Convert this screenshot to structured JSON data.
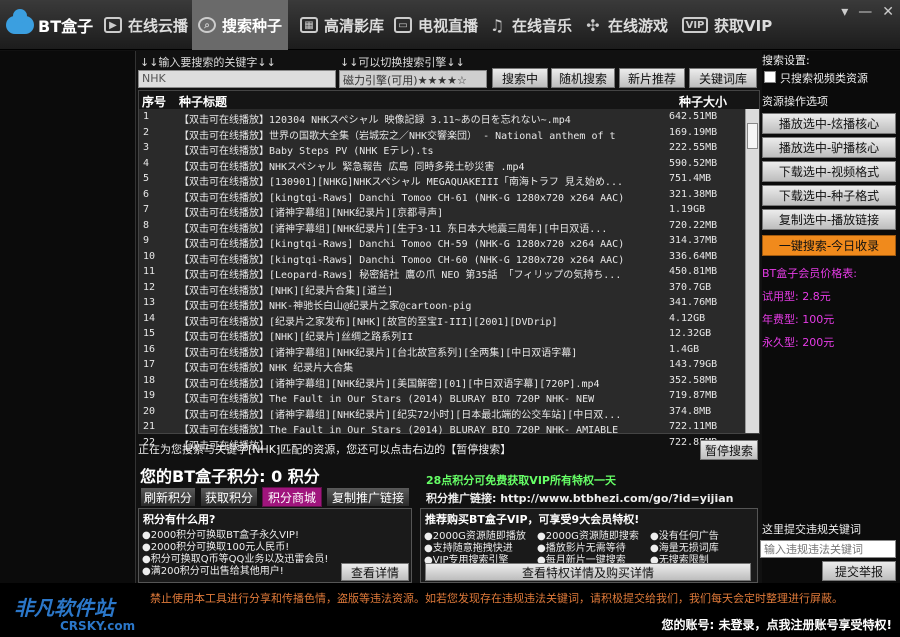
{
  "app": {
    "logo": "BT盒子",
    "window_buttons": [
      "▾",
      "—",
      "✕"
    ]
  },
  "nav": [
    {
      "label": "在线云播",
      "icon": "play-icon"
    },
    {
      "label": "搜索种子",
      "icon": "search-icon",
      "active": true
    },
    {
      "label": "高清影库",
      "icon": "film-icon"
    },
    {
      "label": "电视直播",
      "icon": "tv-icon"
    },
    {
      "label": "在线音乐",
      "icon": "music-icon"
    },
    {
      "label": "在线游戏",
      "icon": "pinwheel-icon"
    },
    {
      "label": "获取VIP",
      "icon": "vip-icon"
    }
  ],
  "search": {
    "hint_keyword": "↓↓输入要搜索的关键字↓↓",
    "hint_engine": "↓↓可以切换搜索引擎↓↓",
    "keyword_value": "NHK",
    "engine_value": "磁力引擎(可用)★★★★☆",
    "btn_searching": "搜索中",
    "btn_random": "随机搜索",
    "btn_new": "新片推荐",
    "btn_keywords": "关键词库"
  },
  "table": {
    "headers": {
      "no": "序号",
      "title": "种子标题",
      "size": "种子大小"
    },
    "rows": [
      {
        "no": "1",
        "title": "【双击可在线播放】120304 NHKスペシャル 映像記録 3.11~あの日を忘れない~.mp4",
        "size": "642.51MB"
      },
      {
        "no": "2",
        "title": "【双击可在线播放】世界の国歌大全集（岩城宏之／NHK交響楽団） - National anthem of t",
        "size": "169.19MB"
      },
      {
        "no": "3",
        "title": "【双击可在线播放】Baby Steps PV (NHK Eテレ).ts",
        "size": "222.55MB"
      },
      {
        "no": "4",
        "title": "【双击可在线播放】NHKスペシャル 緊急報告 広島 同時多発土砂災害 .mp4",
        "size": "590.52MB"
      },
      {
        "no": "5",
        "title": "【双击可在线播放】[130901][NHKG]NHKスペシャル MEGAQUAKEIII「南海トラフ 見え始め...",
        "size": "751.4MB"
      },
      {
        "no": "6",
        "title": "【双击可在线播放】[kingtqi-Raws] Danchi Tomoo CH-61 (NHK-G 1280x720 x264 AAC)",
        "size": "321.38MB"
      },
      {
        "no": "7",
        "title": "【双击可在线播放】[诸神字幕组][NHK纪录片][京都寻声]",
        "size": "1.19GB"
      },
      {
        "no": "8",
        "title": "【双击可在线播放】[诸神字幕组][NHK纪录片][生于3·11 东日本大地震三周年][中日双语...",
        "size": "720.22MB"
      },
      {
        "no": "9",
        "title": "【双击可在线播放】[kingtqi-Raws] Danchi Tomoo CH-59 (NHK-G 1280x720 x264 AAC)",
        "size": "314.37MB"
      },
      {
        "no": "10",
        "title": "【双击可在线播放】[kingtqi-Raws] Danchi Tomoo CH-60 (NHK-G 1280x720 x264 AAC)",
        "size": "336.64MB"
      },
      {
        "no": "11",
        "title": "【双击可在线播放】[Leopard-Raws] 秘密結社 鷹の爪 NEO 第35話 「フィリップの気持ち...",
        "size": "450.81MB"
      },
      {
        "no": "12",
        "title": "【双击可在线播放】[NHK][纪录片合集][道兰]",
        "size": "370.7GB"
      },
      {
        "no": "13",
        "title": "【双击可在线播放】NHK-神驰长白山@纪录片之家@cartoon-pig",
        "size": "341.76MB"
      },
      {
        "no": "14",
        "title": "【双击可在线播放】[纪录片之家发布][NHK][故宫的至宝I-III][2001][DVDrip]",
        "size": "4.12GB"
      },
      {
        "no": "15",
        "title": "【双击可在线播放】[NHK][纪录片]丝绸之路系列II",
        "size": "12.32GB"
      },
      {
        "no": "16",
        "title": "【双击可在线播放】[诸神字幕组][NHK纪录片][台北故宫系列][全两集][中日双语字幕]",
        "size": "1.4GB"
      },
      {
        "no": "17",
        "title": "【双击可在线播放】NHK 纪录片大合集",
        "size": "143.79GB"
      },
      {
        "no": "18",
        "title": "【双击可在线播放】[诸神字幕组][NHK纪录片][美国解密][01][中日双语字幕][720P].mp4",
        "size": "352.58MB"
      },
      {
        "no": "19",
        "title": "【双击可在线播放】The Fault in Our Stars (2014) BLURAY BIO 720P NHK- NEW",
        "size": "719.87MB"
      },
      {
        "no": "20",
        "title": "【双击可在线播放】[诸神字幕组][NHK纪录片][纪实72小时][日本最北端的公交车站][中日双...",
        "size": "374.8MB"
      },
      {
        "no": "21",
        "title": "【双击可在线播放】The Fault in Our Stars (2014) BLURAY BIO 720P NHK- AMIABLE",
        "size": "722.11MB"
      },
      {
        "no": "22",
        "title": "【双击可在线播放】...",
        "size": "722.85MB"
      }
    ]
  },
  "status": {
    "text": "正在为您搜索与关键字[NHK]匹配的资源，您还可以点击右边的【暂停搜索】",
    "pause_btn": "暂停搜索"
  },
  "points": {
    "score_text": "您的BT盒子积分: 0 积分",
    "btn_refresh": "刷新积分",
    "btn_get": "获取积分",
    "btn_mall": "积分商城",
    "btn_copy": "复制推广链接",
    "green_promo": "28点积分可免费获取VIP所有特权一天",
    "link_label": "积分推广链接: http://www.btbhezi.com/go/?id=yijian"
  },
  "uses_box": {
    "title": "积分有什么用?",
    "items": [
      "●2000积分可换取BT盒子永久VIP!",
      "●2000积分可换取100元人民币!",
      "●积分可换取Q币等QQ业务以及迅雷会员!",
      "●满200积分可出售给其他用户!"
    ],
    "btn": "查看详情"
  },
  "vip_box": {
    "title": "推荐购买BT盒子VIP，可享受9大会员特权!",
    "items": [
      "●2000G资源随即播放",
      "●2000G资源随即搜索",
      "●没有任何广告",
      "●支持随意拖拽快进",
      "●播放影片无需等待",
      "●海量无损词库",
      "●VIP专用搜索引擎",
      "●每月新片一键搜索",
      "●无搜索限制"
    ],
    "btn": "查看特权详情及购买详情"
  },
  "right": {
    "settings_label": "搜索设置:",
    "checkbox_label": "只搜索视频类资源",
    "ops_label": "资源操作选项",
    "op_buttons": [
      "播放选中-炫播核心",
      "播放选中-驴播核心",
      "下载选中-视频格式",
      "下载选中-种子格式",
      "复制选中-播放链接"
    ],
    "orange_btn": "一键搜索-今日收录",
    "price_title": "BT盒子会员价格表:",
    "prices": [
      "试用型: 2.8元",
      "年费型: 100元",
      "永久型: 200元"
    ],
    "report_label": "这里提交违规关键词",
    "report_placeholder": "输入违规违法关键词",
    "report_btn": "提交举报"
  },
  "footer": {
    "ticker": "禁止使用本工具进行分享和传播色情，盗版等违法资源。如若您发现存在违规违法关键词，请积极提交给我们，我们每天会定时整理进行屏蔽。",
    "account": "您的账号: 未登录，点我注册账号享受特权!",
    "watermark": "非凡软件站",
    "watermark_sub": "CRSKY.com"
  },
  "colors": {
    "accent_orange": "#f08a1c",
    "magenta": "#e53be5",
    "green": "#66ff66",
    "mall_btn": "#a0157d"
  }
}
